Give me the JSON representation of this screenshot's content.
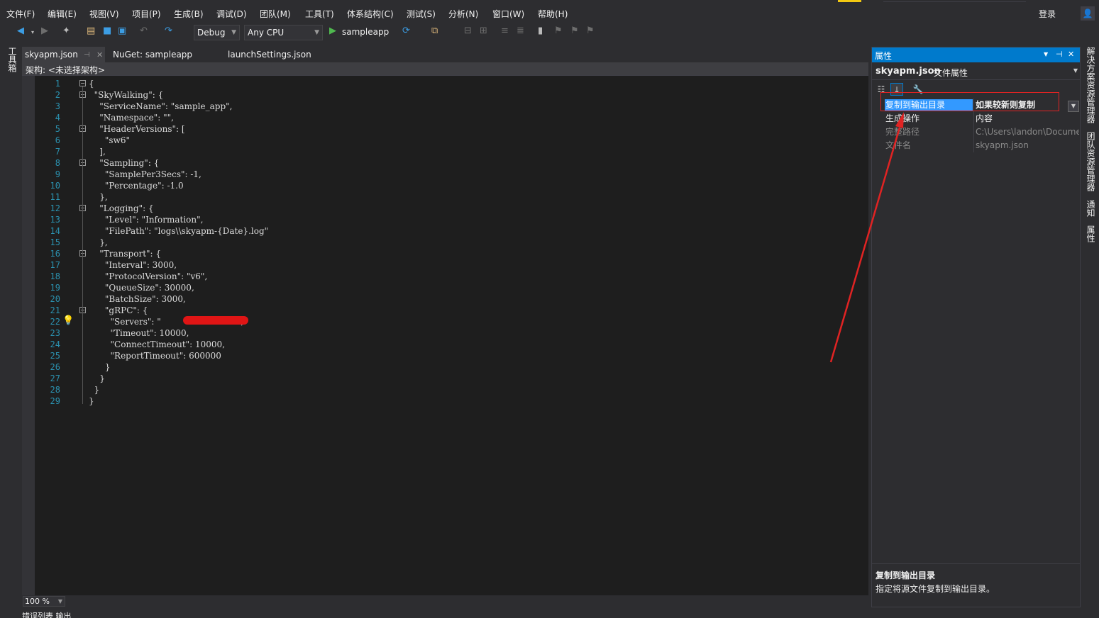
{
  "menu": [
    "文件(F)",
    "编辑(E)",
    "视图(V)",
    "项目(P)",
    "生成(B)",
    "调试(D)",
    "团队(M)",
    "工具(T)",
    "体系结构(C)",
    "测试(S)",
    "分析(N)",
    "窗口(W)",
    "帮助(H)"
  ],
  "login": "登录",
  "toolbar": {
    "config": "Debug",
    "platform": "Any CPU",
    "run_label": "sampleapp"
  },
  "left_rail": "工具箱",
  "tabs": [
    "skyapm.json",
    "NuGet: sampleapp",
    "launchSettings.json"
  ],
  "navbar": "架构: <未选择架构>",
  "code_lines": [
    "{",
    "  \"SkyWalking\": {",
    "    \"ServiceName\": \"sample_app\",",
    "    \"Namespace\": \"\",",
    "    \"HeaderVersions\": [",
    "      \"sw6\"",
    "    ],",
    "    \"Sampling\": {",
    "      \"SamplePer3Secs\": -1,",
    "      \"Percentage\": -1.0",
    "    },",
    "    \"Logging\": {",
    "      \"Level\": \"Information\",",
    "      \"FilePath\": \"logs\\\\skyapm-{Date}.log\"",
    "    },",
    "    \"Transport\": {",
    "      \"Interval\": 3000,",
    "      \"ProtocolVersion\": \"v6\",",
    "      \"QueueSize\": 30000,",
    "      \"BatchSize\": 3000,",
    "      \"gRPC\": {",
    "        \"Servers\": \"                 :11800\",",
    "        \"Timeout\": 10000,",
    "        \"ConnectTimeout\": 10000,",
    "        \"ReportTimeout\": 600000",
    "      }",
    "    }",
    "  }",
    "}"
  ],
  "zoom": "100 %",
  "bottom_tabs": "错误列表  输出",
  "properties": {
    "title": "属性",
    "object_name": "skyapm.json",
    "object_kind": "文件属性",
    "rows": [
      {
        "name": "复制到输出目录",
        "value": "如果较新则复制"
      },
      {
        "name": "生成操作",
        "value": "内容"
      },
      {
        "name": "完整路径",
        "value": "C:\\Users\\landon\\Docume"
      },
      {
        "name": "文件名",
        "value": "skyapm.json"
      }
    ],
    "desc_title": "复制到输出目录",
    "desc_text": "指定将源文件复制到输出目录。"
  },
  "right_rail": [
    "解决方案资源管理器",
    "团队资源管理器",
    "通知",
    "属性"
  ],
  "colors": {
    "accent": "#007acc",
    "selection": "#3399ff",
    "annotation_red": "#e02323",
    "line_numbers": "#2b91af"
  }
}
